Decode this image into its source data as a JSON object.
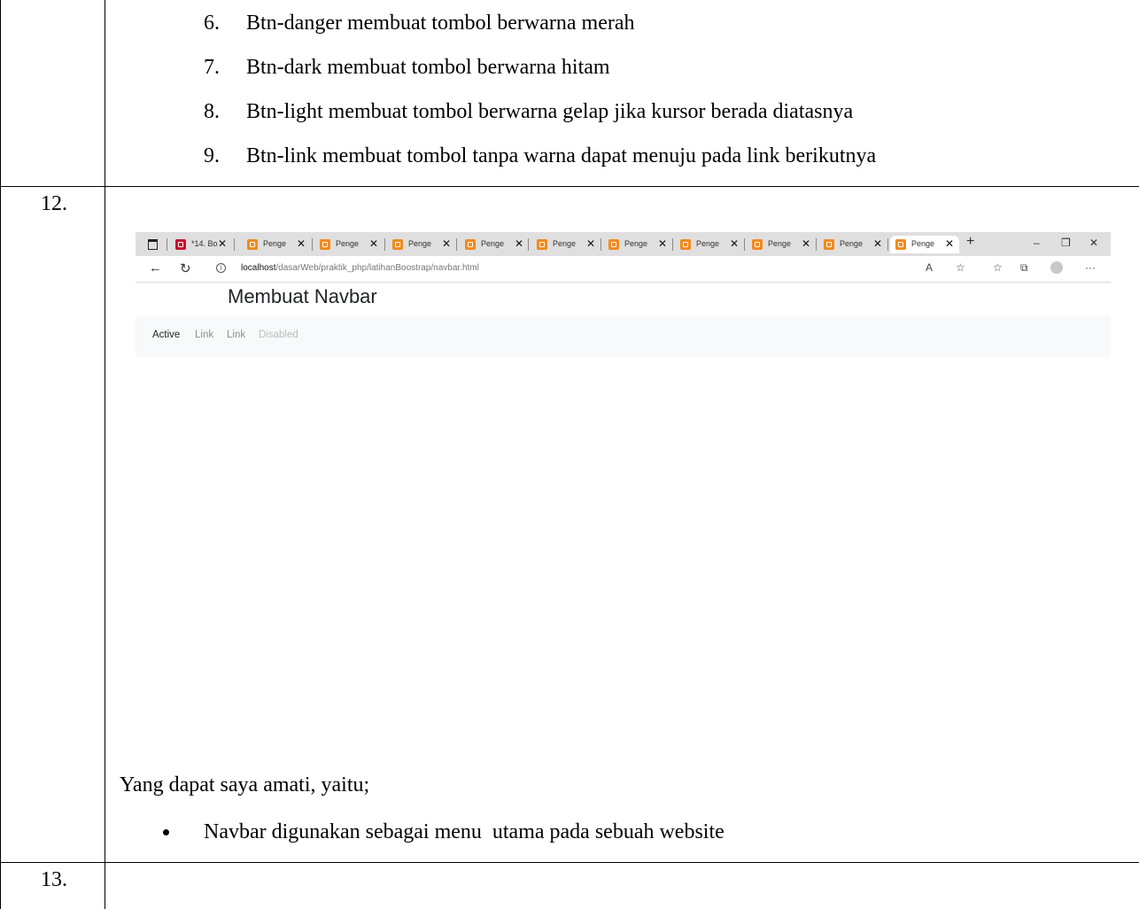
{
  "document": {
    "top_list": [
      {
        "num": "6.",
        "text": "Btn-danger membuat tombol berwarna merah"
      },
      {
        "num": "7.",
        "text": "Btn-dark membuat tombol berwarna hitam"
      },
      {
        "num": "8.",
        "text": "Btn-light membuat tombol berwarna gelap jika kursor berada diatasnya"
      },
      {
        "num": "9.",
        "text": "Btn-link membuat tombol tanpa warna dapat menuju pada link berikutnya"
      }
    ],
    "row_12_number": "12.",
    "observation_intro": "Yang dapat saya amati, yaitu;",
    "observation_bullet": "Navbar digunakan sebagai menu  utama pada sebuah website",
    "row_13_number": "13."
  },
  "browser": {
    "tabs": [
      {
        "label": "*14. Bo",
        "icon": "pdf-icon"
      },
      {
        "label": "Penge",
        "icon": "xampp-icon"
      },
      {
        "label": "Penge",
        "icon": "xampp-icon"
      },
      {
        "label": "Penge",
        "icon": "xampp-icon"
      },
      {
        "label": "Penge",
        "icon": "xampp-icon"
      },
      {
        "label": "Penge",
        "icon": "xampp-icon"
      },
      {
        "label": "Penge",
        "icon": "xampp-icon"
      },
      {
        "label": "Penge",
        "icon": "xampp-icon"
      },
      {
        "label": "Penge",
        "icon": "xampp-icon"
      },
      {
        "label": "Penge",
        "icon": "xampp-icon"
      },
      {
        "label": "Penge",
        "icon": "xampp-icon",
        "active": true
      }
    ],
    "url_host": "localhost",
    "url_path": "/dasarWeb/praktik_php/latihanBoostrap/navbar.html",
    "page_title": "Membuat Navbar",
    "nav_links": [
      {
        "label": "Active",
        "state": "active"
      },
      {
        "label": "Link",
        "state": "normal"
      },
      {
        "label": "Link",
        "state": "normal"
      },
      {
        "label": "Disabled",
        "state": "disabled"
      }
    ]
  },
  "colors": {
    "tabbar_bg": "#dfdfdf",
    "navbar_bg": "#f8f9fa",
    "xampp_orange": "#f28a1e",
    "pdf_red": "#c8102e",
    "nav_active": "#212529",
    "nav_link": "#8a8f94",
    "nav_disabled": "#b9bdc1"
  }
}
